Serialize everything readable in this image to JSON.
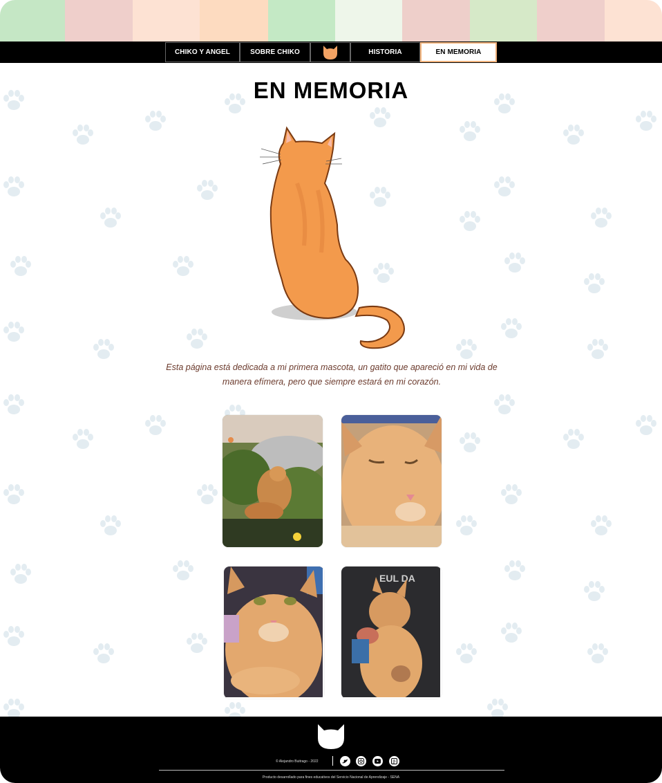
{
  "stripe_colors": [
    "#c5e7c5",
    "#efcfcb",
    "#fde2d3",
    "#fddbc0",
    "#c4e9c5",
    "#eef6ea",
    "#eecfca",
    "#d6e9c8",
    "#efcfcb",
    "#fde2d3"
  ],
  "nav": {
    "items": [
      {
        "label": "CHIKO Y ANGEL"
      },
      {
        "label": "SOBRE CHIKO"
      },
      {
        "label": "HISTORIA"
      },
      {
        "label": "EN MEMORIA"
      }
    ],
    "logo_icon": "cat-head-icon",
    "accent": "#f2a263",
    "active_border": "#f2b37d"
  },
  "main": {
    "title": "EN MEMORIA",
    "dedication": "Esta página está dedicada a mi primera mascota, un gatito que apareció en mi vida de manera efímera, pero que siempre estará en mi corazón.",
    "photos": [
      "cat-in-garden-photo",
      "cat-closeup-photo",
      "cat-lying-photo",
      "cat-held-photo"
    ]
  },
  "footer": {
    "copyright": "© Alejandro Buitrago - 2022",
    "social": [
      "twitter-icon",
      "instagram-icon",
      "youtube-icon",
      "blog-icon"
    ],
    "credit": "Producto desarrollado para fines educativos del Servicio Nacional de Aprendizaje - SENA"
  },
  "colors": {
    "paw": "#e3ecf1",
    "cat_orange": "#f39a4c",
    "dedication_text": "#6b3a2c"
  }
}
